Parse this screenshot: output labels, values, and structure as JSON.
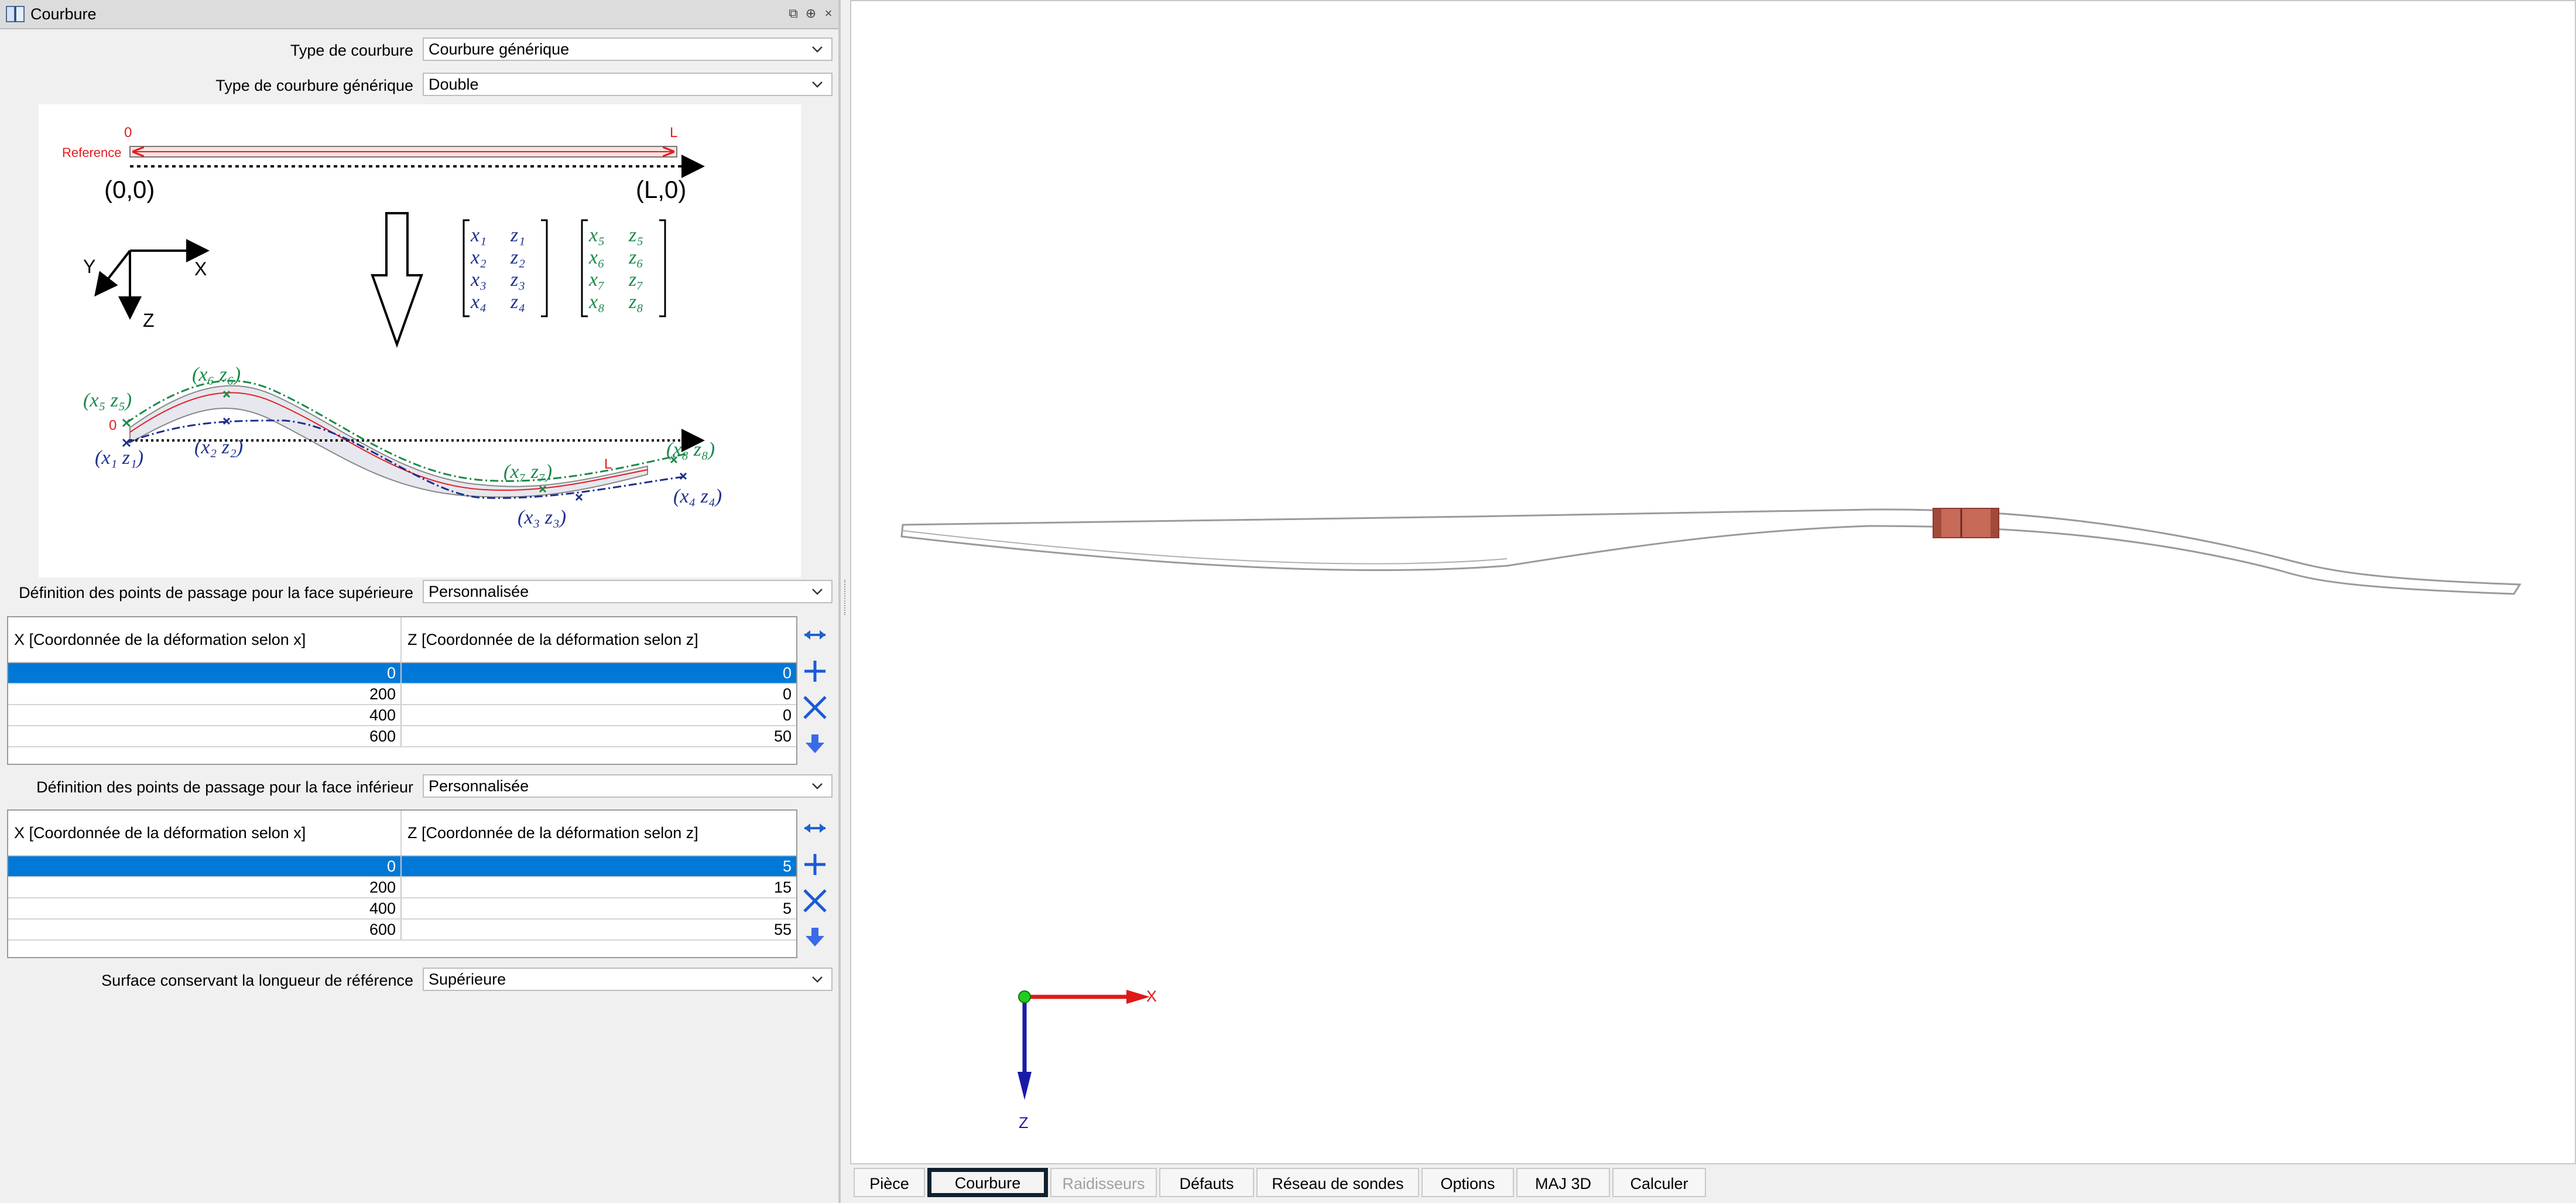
{
  "panel": {
    "title": "Courbure",
    "fields": {
      "type_courbure": {
        "label": "Type de courbure",
        "value": "Courbure générique"
      },
      "type_generique": {
        "label": "Type de courbure générique",
        "value": "Double"
      },
      "def_sup": {
        "label": "Définition des points de passage pour la face supérieure",
        "value": "Personnalisée"
      },
      "def_inf": {
        "label": "Définition des points de passage pour la face inférieur",
        "value": "Personnalisée"
      },
      "surface_ref": {
        "label": "Surface conservant la longueur de référence",
        "value": "Supérieure"
      }
    }
  },
  "diagram": {
    "zero": "0",
    "L": "L",
    "reference": "Reference",
    "origin": "(0,0)",
    "end": "(L,0)",
    "axis_x": "X",
    "axis_y": "Y",
    "axis_z": "Z",
    "matrix_lower": [
      [
        "x₁",
        "z₁"
      ],
      [
        "x₂",
        "z₂"
      ],
      [
        "x₃",
        "z₃"
      ],
      [
        "x₄",
        "z₄"
      ]
    ],
    "matrix_upper": [
      [
        "x₅",
        "z₅"
      ],
      [
        "x₆",
        "z₆"
      ],
      [
        "x₇",
        "z₇"
      ],
      [
        "x₈",
        "z₈"
      ]
    ],
    "pt_upper": [
      "(x₅ z₅)",
      "(x₆ z₆)",
      "(x₇ z₇)",
      "(x₈ z₈)"
    ],
    "pt_lower": [
      "(x₁ z₁)",
      "(x₂ z₂)",
      "(x₃ z₃)",
      "(x₄ z₄)"
    ],
    "colors": {
      "lower": "#1f2f8f",
      "upper": "#1b8a4a",
      "red": "#e02020"
    }
  },
  "table_sup": {
    "col_x": "X [Coordonnée de la déformation selon x]",
    "col_z": "Z [Coordonnée de la déformation selon z]",
    "rows": [
      [
        "0",
        "0"
      ],
      [
        "200",
        "0"
      ],
      [
        "400",
        "0"
      ],
      [
        "600",
        "50"
      ]
    ],
    "selected_row": 0
  },
  "table_inf": {
    "col_x": "X [Coordonnée de la déformation selon x]",
    "col_z": "Z [Coordonnée de la déformation selon z]",
    "rows": [
      [
        "0",
        "5"
      ],
      [
        "200",
        "15"
      ],
      [
        "400",
        "5"
      ],
      [
        "600",
        "55"
      ]
    ],
    "selected_row": 0
  },
  "side_buttons": [
    "arrows-horizontal-icon",
    "plus-icon",
    "close-icon",
    "move-down-icon"
  ],
  "view": {
    "axis_x": "X",
    "axis_z": "Z",
    "colors": {
      "x_axis": "#e01818",
      "z_axis": "#1a1aa8",
      "origin": "#22cc22",
      "part_section": "#c86a58"
    }
  },
  "tabs": [
    {
      "label": "Pièce",
      "state": "normal"
    },
    {
      "label": "Courbure",
      "state": "active"
    },
    {
      "label": "Raidisseurs",
      "state": "disabled"
    },
    {
      "label": "Défauts",
      "state": "normal"
    },
    {
      "label": "Réseau de sondes",
      "state": "normal"
    },
    {
      "label": "Options",
      "state": "normal"
    },
    {
      "label": "MAJ 3D",
      "state": "normal"
    },
    {
      "label": "Calculer",
      "state": "normal"
    }
  ]
}
